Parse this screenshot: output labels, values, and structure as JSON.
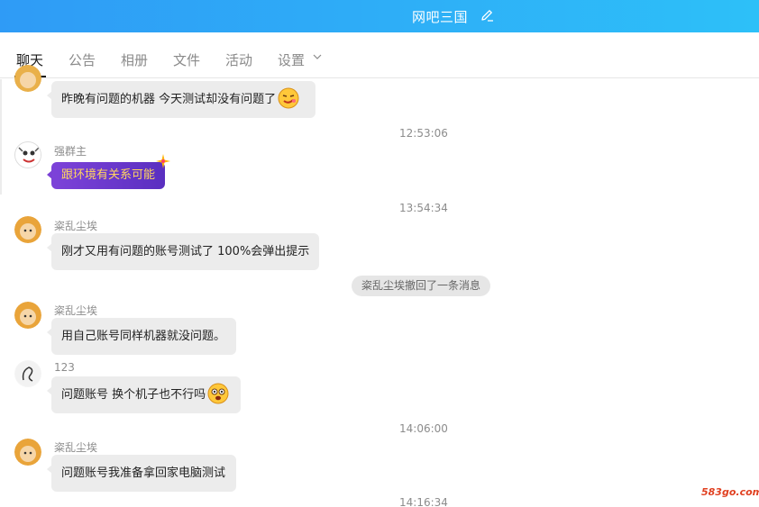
{
  "window": {
    "title": "网吧三国"
  },
  "tabs": [
    {
      "label": "聊天",
      "active": true
    },
    {
      "label": "公告"
    },
    {
      "label": "相册"
    },
    {
      "label": "文件"
    },
    {
      "label": "活动"
    },
    {
      "label": "设置"
    }
  ],
  "messages": [
    {
      "sender": "",
      "text": "昨晚有问题的机器  今天测试却没有问题了",
      "emoji": "smirk-emoji"
    },
    {
      "time": "12:53:06"
    },
    {
      "sender": "强群主",
      "text": "跟环境有关系可能",
      "style": "purple"
    },
    {
      "time": "13:54:34"
    },
    {
      "sender": "粢乱尘埃",
      "text": "刚才又用有问题的账号测试了 100%会弹出提示"
    },
    {
      "system": "粢乱尘埃撤回了一条消息"
    },
    {
      "sender": "粢乱尘埃",
      "text": "用自己账号同样机器就没问题。"
    },
    {
      "sender": "123",
      "text": "问题账号 换个机子也不行吗",
      "emoji": "shocked-emoji"
    },
    {
      "time": "14:06:00"
    },
    {
      "sender": "粢乱尘埃",
      "text": "问题账号我准备拿回家电脑测试"
    },
    {
      "time": "14:16:34"
    }
  ],
  "watermark": "583go.com",
  "colors": {
    "header_start": "#2f9bf6",
    "header_end": "#2dc0f8",
    "bubble": "#ececec",
    "purple": "#6b38cc",
    "purple_text": "#ffd460"
  }
}
